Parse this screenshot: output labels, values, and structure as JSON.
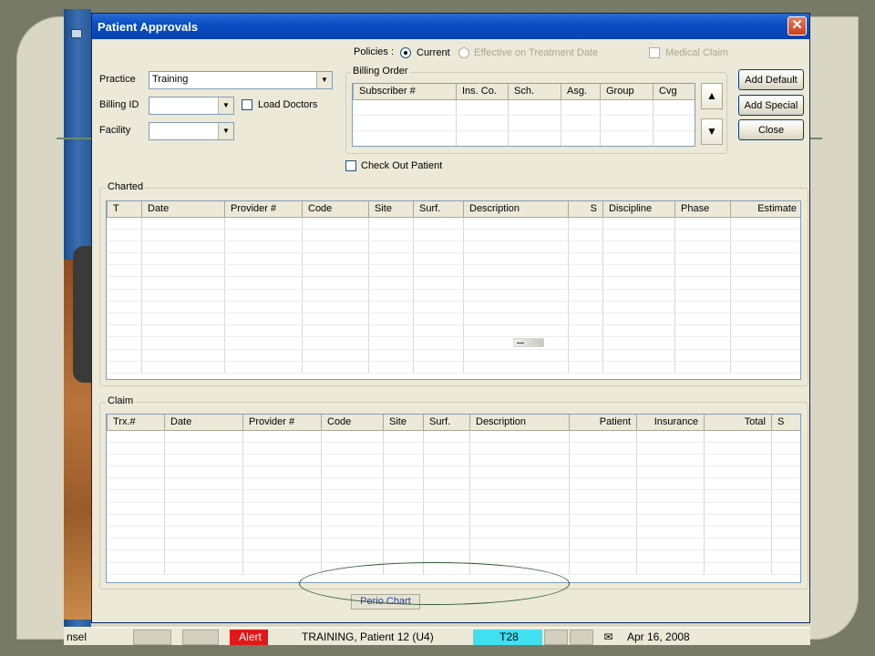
{
  "window": {
    "title": "Patient Approvals",
    "close_glyph": "✕"
  },
  "policies": {
    "label": "Policies :",
    "current_label": "Current",
    "effective_label": "Effective on Treatment Date",
    "medical_claim_label": "Medical Claim"
  },
  "form": {
    "practice_label": "Practice",
    "practice_value": "Training",
    "billing_id_label": "Billing ID",
    "billing_id_value": "",
    "load_doctors_label": "Load Doctors",
    "facility_label": "Facility",
    "facility_value": "",
    "check_out_label": "Check Out Patient"
  },
  "billing_order": {
    "title": "Billing Order",
    "columns": [
      "Subscriber #",
      "Ins. Co.",
      "Sch.",
      "Asg.",
      "Group",
      "Cvg"
    ]
  },
  "buttons": {
    "add_default": "Add Default",
    "add_special": "Add Special",
    "close": "Close",
    "up_glyph": "▲",
    "down_glyph": "▼"
  },
  "charted": {
    "title": "Charted",
    "columns": [
      "T",
      "Date",
      "Provider #",
      "Code",
      "Site",
      "Surf.",
      "Description",
      "S",
      "Discipline",
      "Phase",
      "Estimate"
    ]
  },
  "claim": {
    "title": "Claim",
    "columns": [
      "Trx.#",
      "Date",
      "Provider #",
      "Code",
      "Site",
      "Surf.",
      "Description",
      "Patient",
      "Insurance",
      "Total",
      "S"
    ]
  },
  "perio_chart_label": "Perio Chart",
  "statusbar": {
    "left_text": "nsel",
    "alert_label": "Alert",
    "patient_text": "TRAINING, Patient 12 (U4)",
    "tooth_text": "T28",
    "date_text": "Apr 16, 2008"
  },
  "colors": {
    "titlebar": "#0a4fc4",
    "alert": "#e01818",
    "tooth_badge": "#3fe0f0",
    "perio_link": "#1d3fb0"
  },
  "icons": {
    "titlebar_icon": "app-icon",
    "envelope": "mail-icon"
  }
}
